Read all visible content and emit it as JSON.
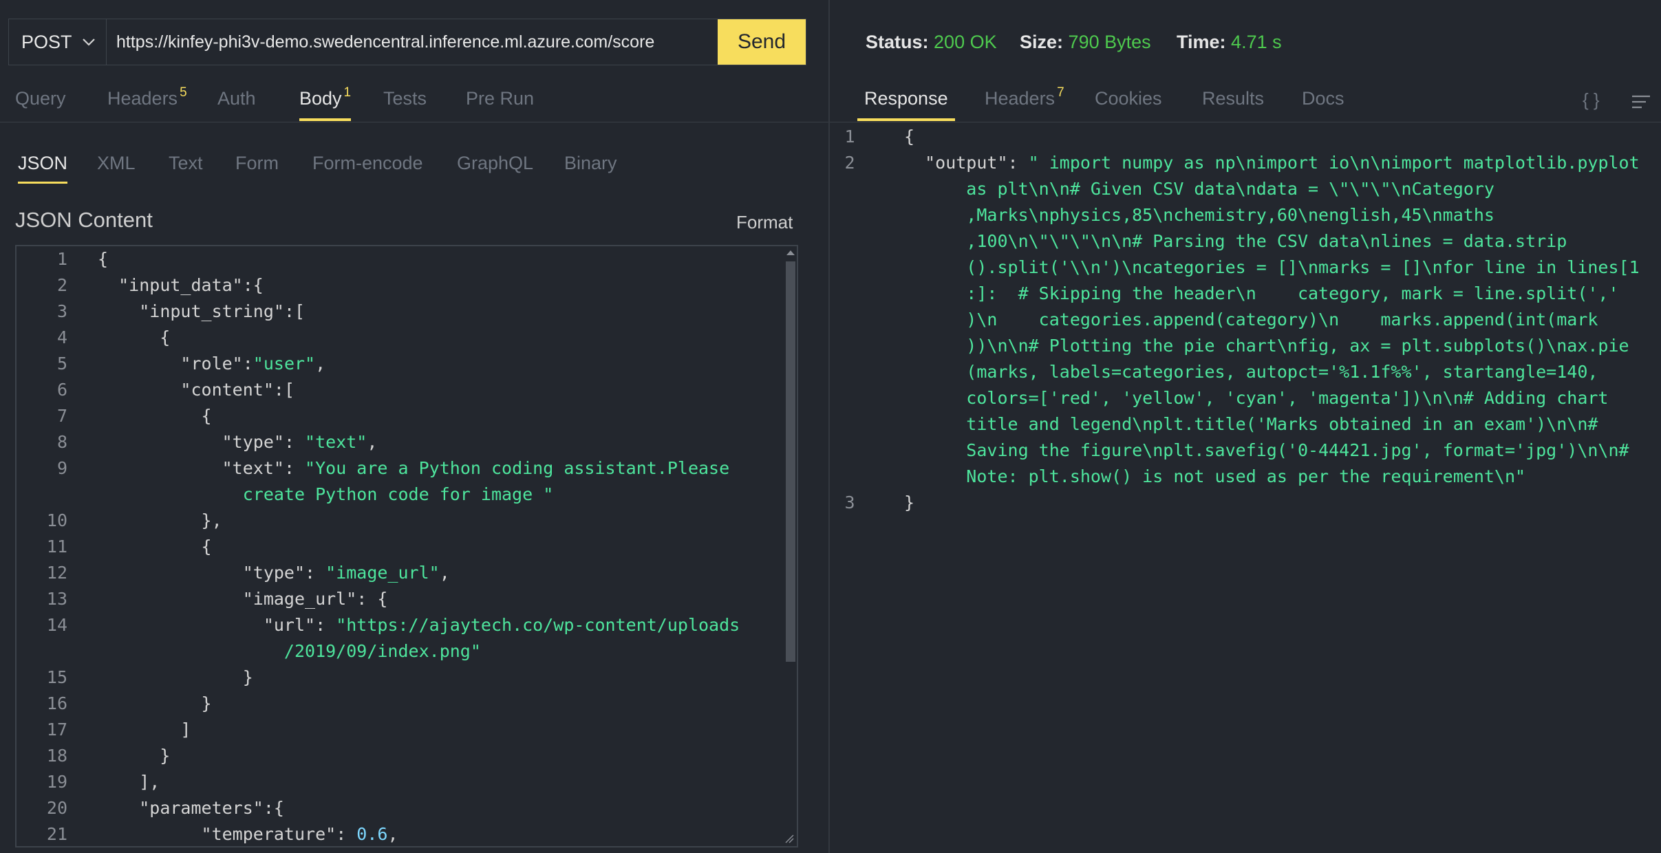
{
  "request": {
    "method": "POST",
    "url": "https://kinfey-phi3v-demo.swedencentral.inference.ml.azure.com/score",
    "send_label": "Send"
  },
  "request_tabs": [
    {
      "label": "Query",
      "badge": ""
    },
    {
      "label": "Headers",
      "badge": "5"
    },
    {
      "label": "Auth",
      "badge": ""
    },
    {
      "label": "Body",
      "badge": "1"
    },
    {
      "label": "Tests",
      "badge": ""
    },
    {
      "label": "Pre Run",
      "badge": ""
    }
  ],
  "body_tabs": [
    "JSON",
    "XML",
    "Text",
    "Form",
    "Form-encode",
    "GraphQL",
    "Binary"
  ],
  "json_content_title": "JSON Content",
  "format_label": "Format",
  "editor_lines": [
    {
      "n": "1",
      "t": "{"
    },
    {
      "n": "2",
      "t": "  \"input_data\":{"
    },
    {
      "n": "3",
      "t": "    \"input_string\":["
    },
    {
      "n": "4",
      "t": "      {"
    },
    {
      "n": "5",
      "t": "        \"role\":\"user\","
    },
    {
      "n": "6",
      "t": "        \"content\":["
    },
    {
      "n": "7",
      "t": "          {"
    },
    {
      "n": "8",
      "t": "            \"type\": \"text\","
    },
    {
      "n": "9",
      "t": "            \"text\": \"You are a Python coding assistant.Please"
    },
    {
      "n": "",
      "t": "              create Python code for image \""
    },
    {
      "n": "10",
      "t": "          },"
    },
    {
      "n": "11",
      "t": "          {"
    },
    {
      "n": "12",
      "t": "              \"type\": \"image_url\","
    },
    {
      "n": "13",
      "t": "              \"image_url\": {"
    },
    {
      "n": "14",
      "t": "                \"url\": \"https://ajaytech.co/wp-content/uploads"
    },
    {
      "n": "",
      "t": "                  /2019/09/index.png\""
    },
    {
      "n": "15",
      "t": "              }"
    },
    {
      "n": "16",
      "t": "          }"
    },
    {
      "n": "17",
      "t": "        ]"
    },
    {
      "n": "18",
      "t": "      }"
    },
    {
      "n": "19",
      "t": "    ],"
    },
    {
      "n": "20",
      "t": "    \"parameters\":{"
    },
    {
      "n": "21",
      "t": "          \"temperature\": 0.6,"
    }
  ],
  "response_status": {
    "status_label": "Status:",
    "status_value": "200 OK",
    "size_label": "Size:",
    "size_value": "790 Bytes",
    "time_label": "Time:",
    "time_value": "4.71 s"
  },
  "response_tabs": [
    {
      "label": "Response",
      "badge": ""
    },
    {
      "label": "Headers",
      "badge": "7"
    },
    {
      "label": "Cookies",
      "badge": ""
    },
    {
      "label": "Results",
      "badge": ""
    },
    {
      "label": "Docs",
      "badge": ""
    }
  ],
  "braces_label": "{ }",
  "response_lines": [
    {
      "n": "1",
      "t": "{"
    },
    {
      "n": "2",
      "t": "  \"output\": \" import numpy as np\\nimport io\\n\\nimport matplotlib.pyplot"
    },
    {
      "n": "",
      "t": "      as plt\\n\\n# Given CSV data\\ndata = \\\"\\\"\\\"\\nCategory"
    },
    {
      "n": "",
      "t": "      ,Marks\\nphysics,85\\nchemistry,60\\nenglish,45\\nmaths"
    },
    {
      "n": "",
      "t": "      ,100\\n\\\"\\\"\\\"\\n\\n# Parsing the CSV data\\nlines = data.strip"
    },
    {
      "n": "",
      "t": "      ().split('\\\\n')\\ncategories = []\\nmarks = []\\nfor line in lines[1"
    },
    {
      "n": "",
      "t": "      :]:  # Skipping the header\\n    category, mark = line.split(','"
    },
    {
      "n": "",
      "t": "      )\\n    categories.append(category)\\n    marks.append(int(mark"
    },
    {
      "n": "",
      "t": "      ))\\n\\n# Plotting the pie chart\\nfig, ax = plt.subplots()\\nax.pie"
    },
    {
      "n": "",
      "t": "      (marks, labels=categories, autopct='%1.1f%%', startangle=140,"
    },
    {
      "n": "",
      "t": "      colors=['red', 'yellow', 'cyan', 'magenta'])\\n\\n# Adding chart"
    },
    {
      "n": "",
      "t": "      title and legend\\nplt.title('Marks obtained in an exam')\\n\\n#"
    },
    {
      "n": "",
      "t": "      Saving the figure\\nplt.savefig('0-44421.jpg', format='jpg')\\n\\n#"
    },
    {
      "n": "",
      "t": "      Note: plt.show() is not used as per the requirement\\n\""
    },
    {
      "n": "3",
      "t": "}"
    }
  ]
}
